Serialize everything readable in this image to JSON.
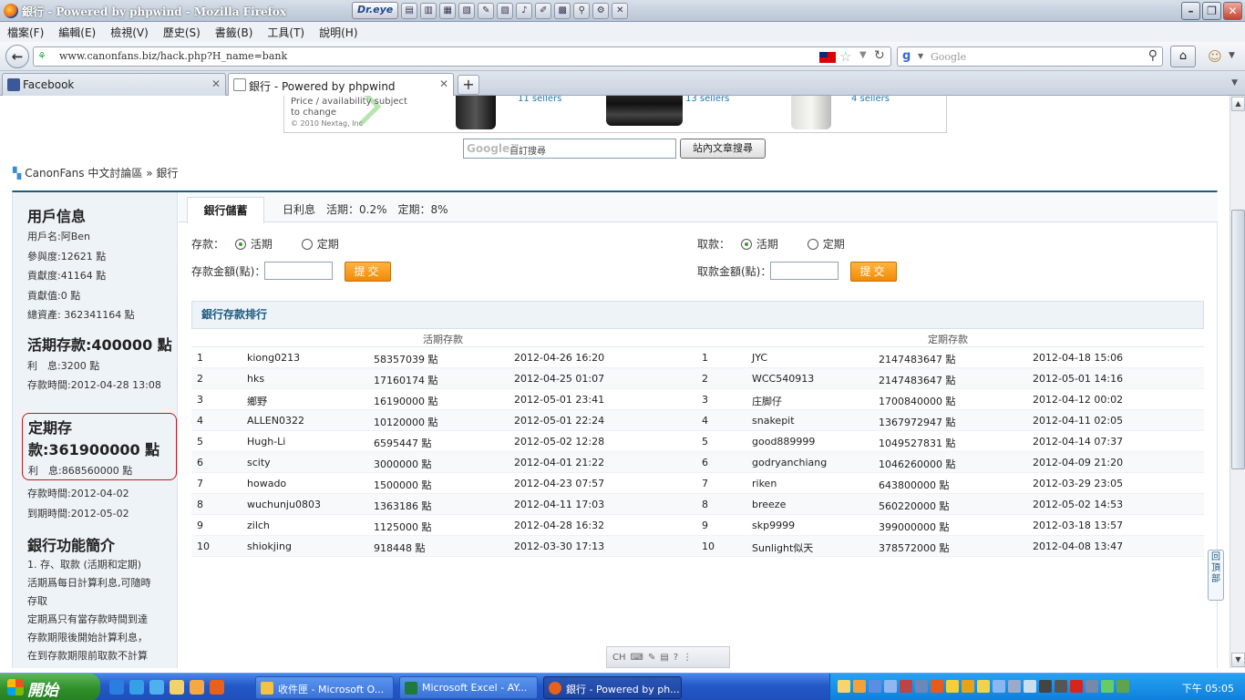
{
  "window": {
    "title": "銀行 - Powered by phpwind - Mozilla Firefox"
  },
  "toolbar": {
    "dreye": "Dr.eye"
  },
  "menu": [
    "檔案(F)",
    "編輯(E)",
    "檢視(V)",
    "歷史(S)",
    "書籤(B)",
    "工具(T)",
    "說明(H)"
  ],
  "nav": {
    "url": "www.canonfans.biz/hack.php?H_name=bank",
    "search_placeholder": "Google"
  },
  "tabs": [
    {
      "label": "Facebook"
    },
    {
      "label": "銀行 - Powered by phpwind"
    }
  ],
  "ad": {
    "text1": "Price / availability subject",
    "text2": "to change",
    "copyright": "© 2010 Nextag, Inc",
    "sellers": [
      "11 sellers",
      "13 sellers",
      "4 sellers"
    ]
  },
  "site_search": {
    "label": "自訂搜尋",
    "button": "站內文章搜尋",
    "logo": "Google™"
  },
  "breadcrumb": {
    "home": "CanonFans 中文討論區",
    "sep": "»",
    "current": "銀行"
  },
  "sidebar": {
    "user_title": "用戶信息",
    "username": "用戶名:阿Ben",
    "participation": "參與度:12621 點",
    "contribution": "貢獻度:41164 點",
    "contrib_value": "貢獻值:0 點",
    "total_assets": "總資產: 362341164 點",
    "current_deposit": "活期存款:400000 點",
    "current_interest": "利　息:3200 點",
    "current_time": "存款時間:2012-04-28 13:08",
    "fixed_deposit": "定期存款:361900000 點",
    "fixed_interest": "利　息:868560000 點",
    "fixed_time": "存款時間:2012-04-02",
    "fixed_due": "到期時間:2012-05-02",
    "intro_title": "銀行功能簡介",
    "intro_lines": [
      "1. 存、取款 (活期和定期)",
      "活期爲每日計算利息,可隨時",
      "存取",
      "定期爲只有當存款時間到達",
      "存款期限後開始計算利息，",
      "在到存款期限前取款不計算"
    ]
  },
  "bank": {
    "tab": "銀行儲蓄",
    "rate_info": "日利息　活期：0.2%　定期：8%",
    "deposit_label": "存款：",
    "withdraw_label": "取款：",
    "opt_current": "活期",
    "opt_fixed": "定期",
    "deposit_amount": "存款金額(點)：",
    "withdraw_amount": "取款金額(點)：",
    "submit": "提交",
    "rank_title": "銀行存款排行",
    "col_current": "活期存款",
    "col_fixed": "定期存款",
    "current_rows": [
      [
        "1",
        "kiong0213",
        "58357039 點",
        "2012-04-26 16:20"
      ],
      [
        "2",
        "hks",
        "17160174 點",
        "2012-04-25 01:07"
      ],
      [
        "3",
        "鄉野",
        "16190000 點",
        "2012-05-01 23:41"
      ],
      [
        "4",
        "ALLEN0322",
        "10120000 點",
        "2012-05-01 22:24"
      ],
      [
        "5",
        "Hugh-Li",
        "6595447 點",
        "2012-05-02 12:28"
      ],
      [
        "6",
        "scity",
        "3000000 點",
        "2012-04-01 21:22"
      ],
      [
        "7",
        "howado",
        "1500000 點",
        "2012-04-23 07:57"
      ],
      [
        "8",
        "wuchunju0803",
        "1363186 點",
        "2012-04-11 17:03"
      ],
      [
        "9",
        "zilch",
        "1125000 點",
        "2012-04-28 16:32"
      ],
      [
        "10",
        "shiokjing",
        "918448 點",
        "2012-03-30 17:13"
      ]
    ],
    "fixed_rows": [
      [
        "1",
        "JYC",
        "2147483647 點",
        "2012-04-18 15:06"
      ],
      [
        "2",
        "WCC540913",
        "2147483647 點",
        "2012-05-01 14:16"
      ],
      [
        "3",
        "庄脚仔",
        "1700840000 點",
        "2012-04-12 00:02"
      ],
      [
        "4",
        "snakepit",
        "1367972947 點",
        "2012-04-11 02:05"
      ],
      [
        "5",
        "good889999",
        "1049527831 點",
        "2012-04-14 07:37"
      ],
      [
        "6",
        "godryanchiang",
        "1046260000 點",
        "2012-04-09 21:20"
      ],
      [
        "7",
        "riken",
        "643800000 點",
        "2012-03-29 23:05"
      ],
      [
        "8",
        "breeze",
        "560220000 點",
        "2012-05-02 14:53"
      ],
      [
        "9",
        "skp9999",
        "399000000 點",
        "2012-03-18 13:57"
      ],
      [
        "10",
        "Sunlight似天",
        "378572000 點",
        "2012-04-08 13:47"
      ]
    ],
    "back_top": "回頂部"
  },
  "ime": {
    "label": "CH"
  },
  "taskbar": {
    "start": "開始",
    "tasks": [
      "收件匣 - Microsoft O...",
      "Microsoft Excel - AY...",
      "銀行 - Powered by ph..."
    ],
    "clock": "下午 05:05"
  }
}
